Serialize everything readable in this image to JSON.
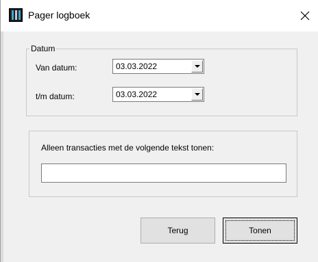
{
  "window": {
    "title": "Pager logboek"
  },
  "datum": {
    "legend": "Datum",
    "van_label": "Van datum:",
    "van_value": "03.03.2022",
    "tm_label": "t/m datum:",
    "tm_value": "03.03.2022"
  },
  "filter": {
    "label": "Alleen transacties met de volgende tekst tonen:",
    "value": ""
  },
  "buttons": {
    "terug": "Terug",
    "tonen": "Tonen"
  },
  "icons": {
    "app": "pager-app-icon",
    "close": "close-icon",
    "dropdown": "dropdown-arrow-icon"
  }
}
